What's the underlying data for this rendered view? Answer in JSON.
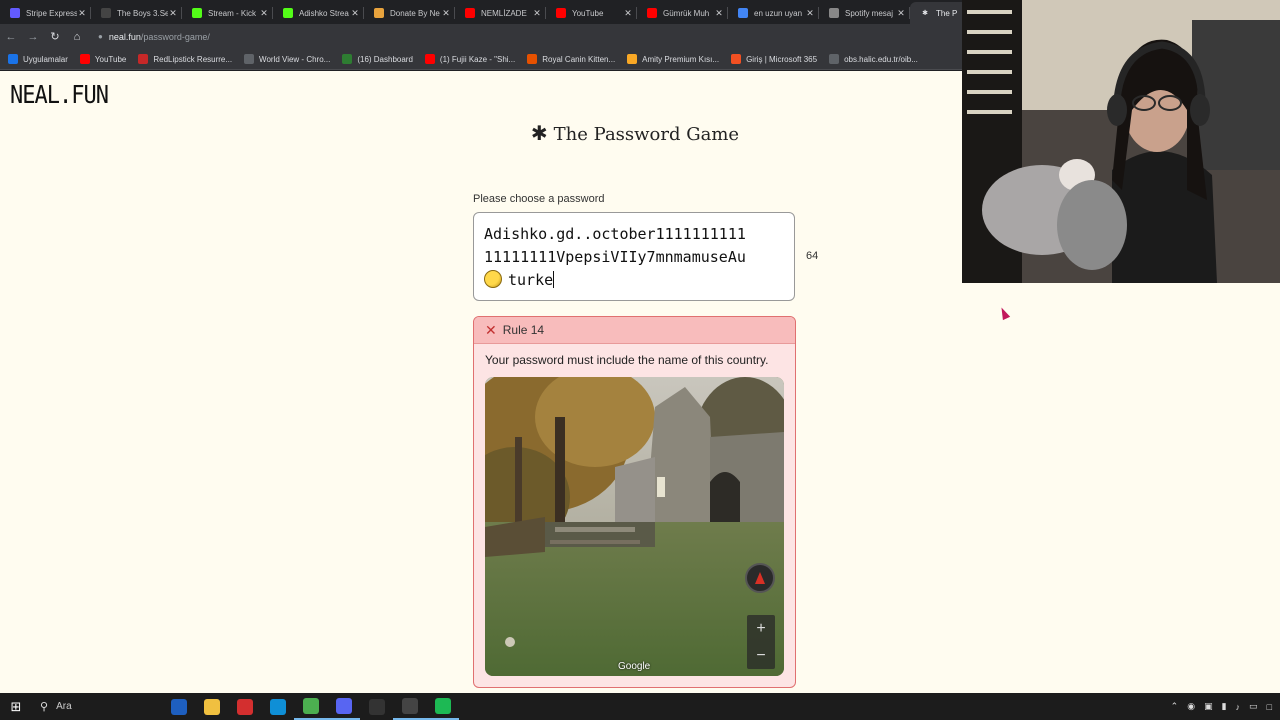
{
  "browser": {
    "tabs": [
      {
        "label": "Stripe Express",
        "icon": "stripe-icon",
        "color": "#635bff",
        "active": false
      },
      {
        "label": "The Boys 3.Se",
        "icon": "video-icon",
        "color": "#444444",
        "active": false
      },
      {
        "label": "Stream - Kick",
        "icon": "kick-icon",
        "color": "#53fc18",
        "active": false
      },
      {
        "label": "Adishko Strea",
        "icon": "kick-icon",
        "color": "#53fc18",
        "active": false
      },
      {
        "label": "Donate By Ne",
        "icon": "donate-icon",
        "color": "#e8a33d",
        "active": false
      },
      {
        "label": "NEMLİZADE",
        "icon": "youtube-icon",
        "color": "#ff0000",
        "active": false
      },
      {
        "label": "YouTube",
        "icon": "youtube-icon",
        "color": "#ff0000",
        "active": false
      },
      {
        "label": "Gümrük Muh",
        "icon": "youtube-icon",
        "color": "#ff0000",
        "active": false
      },
      {
        "label": "en uzun uyan",
        "icon": "google-icon",
        "color": "#4285f4",
        "active": false
      },
      {
        "label": "Spotify mesaj",
        "icon": "openai-icon",
        "color": "#888888",
        "active": false
      },
      {
        "label": "The P",
        "icon": "asterisk-icon",
        "color": "#35363a",
        "active": true
      }
    ],
    "url_host": "neal.fun",
    "url_path": "/password-game/",
    "bookmarks": [
      {
        "label": "Uygulamalar",
        "icon": "apps-grid-icon",
        "color": "#1a73e8"
      },
      {
        "label": "YouTube",
        "icon": "youtube-icon",
        "color": "#ff0000"
      },
      {
        "label": "RedLipstick Resurre...",
        "icon": "bookmark-red-icon",
        "color": "#c62828"
      },
      {
        "label": "World View - Chro...",
        "icon": "world-view-icon",
        "color": "#5f6368"
      },
      {
        "label": "(16) Dashboard",
        "icon": "discord-icon",
        "color": "#2e7d32"
      },
      {
        "label": "(1) Fujii Kaze - \"Shi...",
        "icon": "youtube-icon",
        "color": "#ff0000"
      },
      {
        "label": "Royal Canin Kitten...",
        "icon": "royal-canin-icon",
        "color": "#e65100"
      },
      {
        "label": "Amity Premium Kısı...",
        "icon": "amity-icon",
        "color": "#f9a825"
      },
      {
        "label": "Giriş | Microsoft 365",
        "icon": "microsoft-icon",
        "color": "#f25022"
      },
      {
        "label": "obs.halic.edu.tr/oib...",
        "icon": "globe-icon",
        "color": "#5f6368"
      }
    ]
  },
  "page": {
    "logo": "NEAL.FUN",
    "title_star": "✱",
    "title": "The Password Game",
    "choose_label": "Please choose a password",
    "password_lines": [
      "Adishko.gd..october1111111111",
      "11111111VpepsiVIIy7mnmamuseAu"
    ],
    "password_tail": "turke",
    "char_count": "64",
    "rule": {
      "title": "Rule 14",
      "text": "Your password must include the name of this country.",
      "map_credit": "Google",
      "zoom_in": "+",
      "zoom_out": "−"
    }
  },
  "taskbar": {
    "search_label": "Ara",
    "apps": [
      {
        "name": "widgets-app-icon",
        "color": "#1e5fbf",
        "running": false
      },
      {
        "name": "file-explorer-icon",
        "color": "#f0c040",
        "running": false
      },
      {
        "name": "opera-icon",
        "color": "#d32f2f",
        "running": false
      },
      {
        "name": "edge-icon",
        "color": "#0f8fd6",
        "running": false
      },
      {
        "name": "chrome-icon",
        "color": "#4caf50",
        "running": true
      },
      {
        "name": "discord-icon",
        "color": "#5865f2",
        "running": true
      },
      {
        "name": "steam-icon",
        "color": "#333333",
        "running": false
      },
      {
        "name": "obs-icon",
        "color": "#444444",
        "running": true
      },
      {
        "name": "spotify-icon",
        "color": "#1db954",
        "running": true
      }
    ]
  }
}
